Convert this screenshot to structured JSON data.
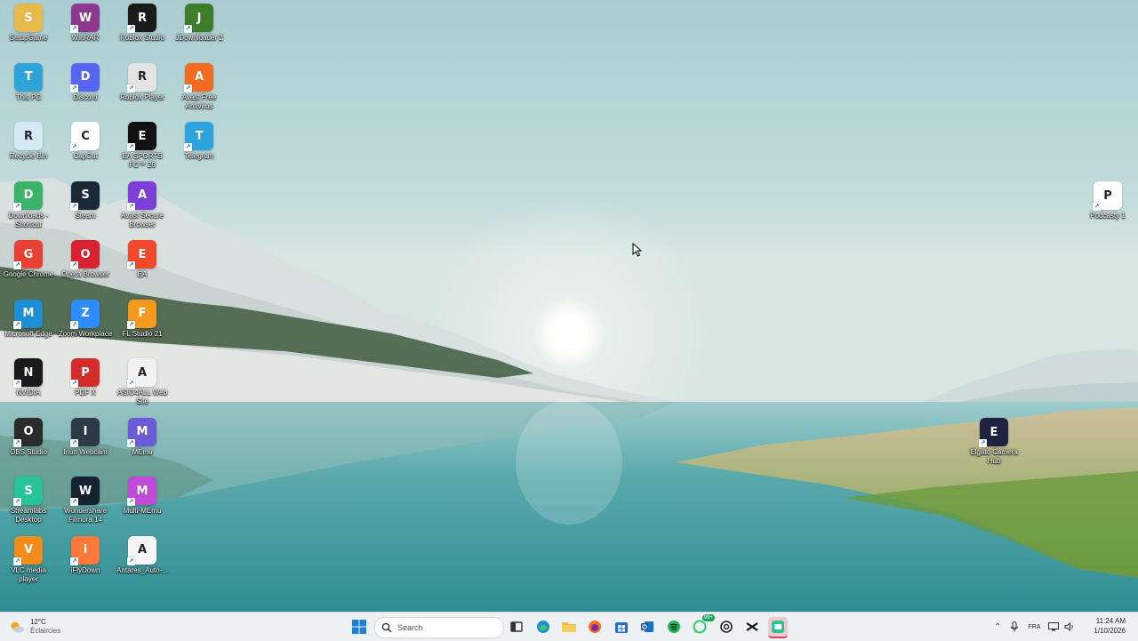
{
  "desktop": {
    "icons": [
      {
        "label": "SetupGame",
        "icon": "folder-icon",
        "color": "#e6b94a"
      },
      {
        "label": "WinRAR",
        "icon": "winrar-icon",
        "color": "#8b3a8f"
      },
      {
        "label": "Roblox Studio",
        "icon": "roblox-studio-icon",
        "color": "#1b1b1b"
      },
      {
        "label": "JDownloader 2",
        "icon": "jdownloader-icon",
        "color": "#3f7d2a"
      },
      {
        "label": "This PC",
        "icon": "monitor-icon",
        "color": "#2fa4d9"
      },
      {
        "label": "Discord",
        "icon": "discord-icon",
        "color": "#5865f2"
      },
      {
        "label": "Roblox Player",
        "icon": "roblox-player-icon",
        "color": "#e4e4e4"
      },
      {
        "label": "Avast Free Antivirus",
        "icon": "avast-icon",
        "color": "#f36b21"
      },
      {
        "label": "Recycle Bin",
        "icon": "recycle-bin-icon",
        "color": "#d5e9f3"
      },
      {
        "label": "CapCut",
        "icon": "capcut-icon",
        "color": "#ffffff"
      },
      {
        "label": "EA SPORTS FC™ 26",
        "icon": "ea-fc-icon",
        "color": "#111111"
      },
      {
        "label": "Telegram",
        "icon": "telegram-icon",
        "color": "#2aa3df"
      },
      {
        "label": "Downloads - Shortcut",
        "icon": "downloads-folder-icon",
        "color": "#3bb36b"
      },
      {
        "label": "Steam",
        "icon": "steam-icon",
        "color": "#1b2838"
      },
      {
        "label": "Avast Secure Browser",
        "icon": "avast-browser-icon",
        "color": "#7b3fd6"
      },
      {
        "label": "Google Chrome",
        "icon": "chrome-icon",
        "color": "#e94235"
      },
      {
        "label": "Opera Browser",
        "icon": "opera-icon",
        "color": "#d7232f"
      },
      {
        "label": "EA",
        "icon": "ea-icon",
        "color": "#f04a2b"
      },
      {
        "label": "Microsoft Edge",
        "icon": "edge-icon",
        "color": "#1e8fd6"
      },
      {
        "label": "Zoom Workplace",
        "icon": "zoom-icon",
        "color": "#2d8cff"
      },
      {
        "label": "FL Studio 21",
        "icon": "fl-studio-icon",
        "color": "#f39a1f"
      },
      {
        "label": "NVIDIA",
        "icon": "nvidia-icon",
        "color": "#1a1a1a"
      },
      {
        "label": "PDF X",
        "icon": "pdf-icon",
        "color": "#d42b2b"
      },
      {
        "label": "ASIO4ALL Web Site",
        "icon": "asio-icon",
        "color": "#f2f2f2"
      },
      {
        "label": "OBS Studio",
        "icon": "obs-icon",
        "color": "#2b2b2b"
      },
      {
        "label": "Iriun Webcam",
        "icon": "webcam-icon",
        "color": "#2d3a45"
      },
      {
        "label": "MEmu",
        "icon": "memu-icon",
        "color": "#6a5bd9"
      },
      {
        "label": "Streamlabs Desktop",
        "icon": "streamlabs-icon",
        "color": "#27c49a"
      },
      {
        "label": "Wondershare Filmora 14",
        "icon": "filmora-icon",
        "color": "#15232f"
      },
      {
        "label": "Multi-MEmu",
        "icon": "multi-memu-icon",
        "color": "#c04bd8"
      },
      {
        "label": "VLC media player",
        "icon": "vlc-icon",
        "color": "#f28c1b"
      },
      {
        "label": "iFlyDown",
        "icon": "iflydown-icon",
        "color": "#ff7a3a"
      },
      {
        "label": "Antares_Auto-...",
        "icon": "antares-icon",
        "color": "#f5f5f5"
      },
      {
        "label": "Podcasty 1",
        "icon": "podcast-icon",
        "color": "#ffffff"
      },
      {
        "label": "Elgato Camera Hub",
        "icon": "elgato-icon",
        "color": "#1d2340"
      }
    ]
  },
  "taskbar": {
    "weather": {
      "temp": "12°C",
      "desc": "Éclaircies"
    },
    "search_placeholder": "Search",
    "apps": [
      {
        "name": "start-button",
        "icon": "windows-icon",
        "color": "#1e7fd8"
      },
      {
        "name": "task-view-button",
        "icon": "task-view-icon",
        "color": "#333333"
      },
      {
        "name": "edge-taskbar",
        "icon": "edge-icon",
        "color": "#1e8fd6"
      },
      {
        "name": "file-explorer-taskbar",
        "icon": "folder-icon",
        "color": "#e6b94a"
      },
      {
        "name": "firefox-taskbar",
        "icon": "firefox-icon",
        "color": "#ff6a1f"
      },
      {
        "name": "store-taskbar",
        "icon": "store-icon",
        "color": "#1f6fd1"
      },
      {
        "name": "outlook-taskbar",
        "icon": "outlook-icon",
        "color": "#1a73c8"
      },
      {
        "name": "spotify-taskbar",
        "icon": "spotify-icon",
        "color": "#1db954"
      },
      {
        "name": "whatsapp-taskbar",
        "icon": "whatsapp-icon",
        "color": "#25d366"
      },
      {
        "name": "chatgpt-taskbar",
        "icon": "chatgpt-icon",
        "color": "#222222"
      },
      {
        "name": "capcut-taskbar",
        "icon": "capcut-icon",
        "color": "#111111"
      },
      {
        "name": "streamlabs-taskbar",
        "icon": "streamlabs-icon",
        "color": "#27c49a"
      }
    ],
    "whatsapp_badge": "99+",
    "tray": {
      "language": "FRA"
    },
    "clock": {
      "time": "11:24 AM",
      "date": "1/10/2026"
    }
  }
}
